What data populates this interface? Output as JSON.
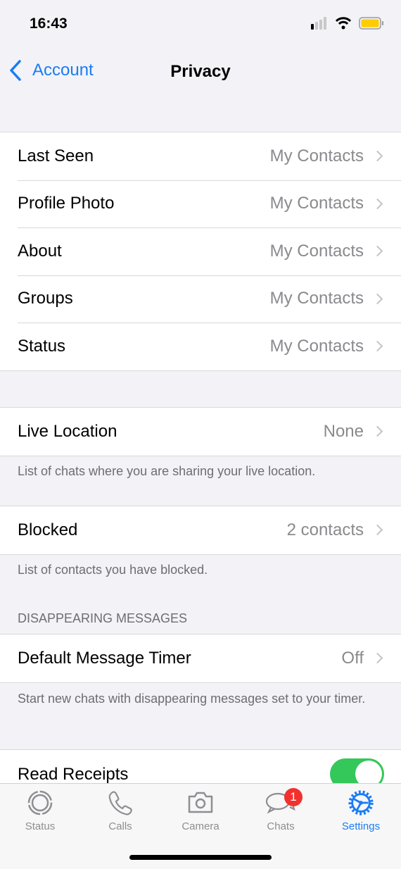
{
  "status_bar": {
    "time": "16:43",
    "battery_color": "#ffcc00"
  },
  "nav": {
    "back_label": "Account",
    "title": "Privacy"
  },
  "privacy_group": [
    {
      "label": "Last Seen",
      "value": "My Contacts"
    },
    {
      "label": "Profile Photo",
      "value": "My Contacts"
    },
    {
      "label": "About",
      "value": "My Contacts"
    },
    {
      "label": "Groups",
      "value": "My Contacts"
    },
    {
      "label": "Status",
      "value": "My Contacts"
    }
  ],
  "live_location": {
    "label": "Live Location",
    "value": "None",
    "footer": "List of chats where you are sharing your live location."
  },
  "blocked": {
    "label": "Blocked",
    "value": "2 contacts",
    "footer": "List of contacts you have blocked."
  },
  "disappearing": {
    "header": "DISAPPEARING MESSAGES",
    "label": "Default Message Timer",
    "value": "Off",
    "footer": "Start new chats with disappearing messages set to your timer."
  },
  "read_receipts": {
    "label": "Read Receipts",
    "enabled": true
  },
  "tabs": [
    {
      "label": "Status",
      "icon": "status-icon"
    },
    {
      "label": "Calls",
      "icon": "phone-icon"
    },
    {
      "label": "Camera",
      "icon": "camera-icon"
    },
    {
      "label": "Chats",
      "icon": "chats-icon",
      "badge": "1"
    },
    {
      "label": "Settings",
      "icon": "settings-gear-icon",
      "active": true
    }
  ],
  "colors": {
    "accent": "#1a7cf5",
    "toggle_on": "#34c759",
    "badge": "#f2312f"
  }
}
